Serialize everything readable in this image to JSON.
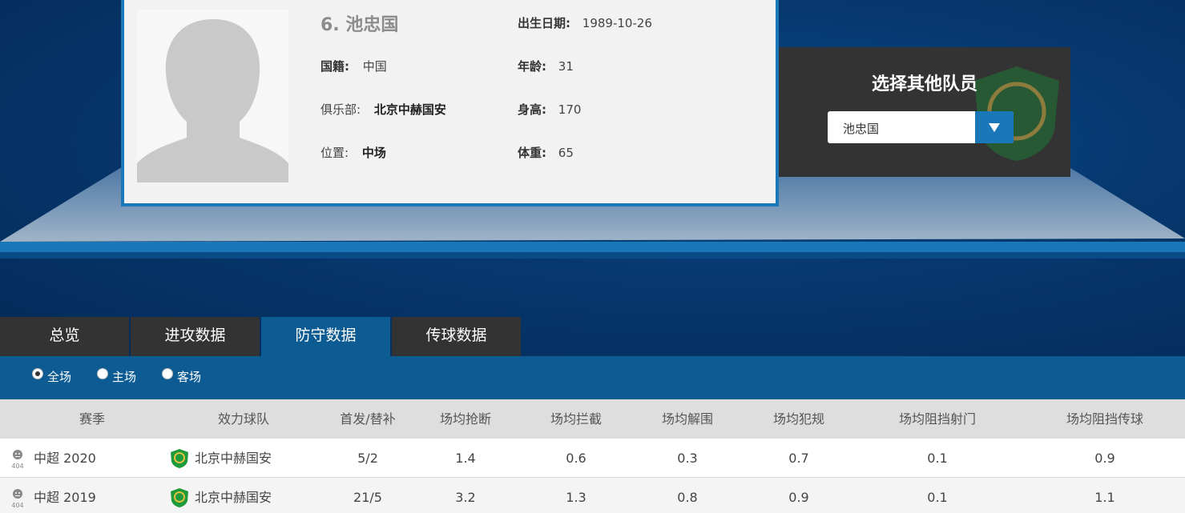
{
  "player": {
    "name": "6. 池忠国",
    "fields": {
      "birth_label": "出生日期:",
      "birth_value": "1989-10-26",
      "nation_label": "国籍:",
      "nation_value": "中国",
      "age_label": "年龄:",
      "age_value": "31",
      "club_label": "俱乐部:",
      "club_value": "北京中赫国安",
      "height_label": "身高:",
      "height_value": "170",
      "position_label": "位置:",
      "position_value": "中场",
      "weight_label": "体重:",
      "weight_value": "65"
    }
  },
  "selector": {
    "title": "选择其他队员",
    "selected": "池忠国"
  },
  "tabs": [
    {
      "label": "总览"
    },
    {
      "label": "进攻数据"
    },
    {
      "label": "防守数据"
    },
    {
      "label": "传球数据"
    }
  ],
  "active_tab": "防守数据",
  "filters": [
    {
      "label": "全场",
      "checked": true
    },
    {
      "label": "主场",
      "checked": false
    },
    {
      "label": "客场",
      "checked": false
    }
  ],
  "table": {
    "headers": [
      "赛季",
      "效力球队",
      "首发/替补",
      "场均抢断",
      "场均拦截",
      "场均解围",
      "场均犯规",
      "场均阻挡射门",
      "场均阻挡传球"
    ],
    "rows": [
      [
        "中超 2020",
        "北京中赫国安",
        "5/2",
        "1.4",
        "0.6",
        "0.3",
        "0.7",
        "0.1",
        "0.9"
      ],
      [
        "中超 2019",
        "北京中赫国安",
        "21/5",
        "3.2",
        "1.3",
        "0.8",
        "0.9",
        "0.1",
        "1.1"
      ]
    ]
  },
  "icons": {
    "season_icon": "404-face-icon",
    "team_logo": "guoan-club-logo"
  },
  "colors": {
    "accent": "#1b78b8",
    "tab_active": "#0c5b93",
    "tab_bg": "#333333",
    "club_green": "#1e9a3a"
  }
}
